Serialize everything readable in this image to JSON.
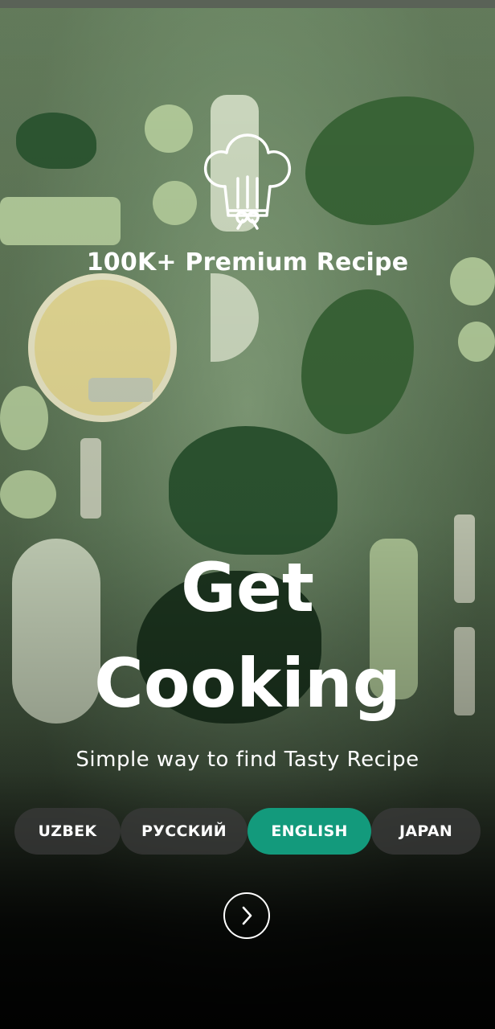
{
  "onboarding": {
    "tagline": "100K+ Premium Recipe",
    "title_line1": "Get",
    "title_line2": "Cooking",
    "subtitle": "Simple way to find Tasty Recipe",
    "icons": {
      "logo": "chef-hat-icon",
      "next": "chevron-right-icon"
    }
  },
  "languages": [
    {
      "label": "UZBEK",
      "selected": false
    },
    {
      "label": "РУССКИЙ",
      "selected": false
    },
    {
      "label": "ENGLISH",
      "selected": true
    },
    {
      "label": "JAPAN",
      "selected": false
    }
  ],
  "colors": {
    "accent": "#139a7c",
    "text": "#ffffff",
    "pill_bg": "#3c3c3c"
  }
}
